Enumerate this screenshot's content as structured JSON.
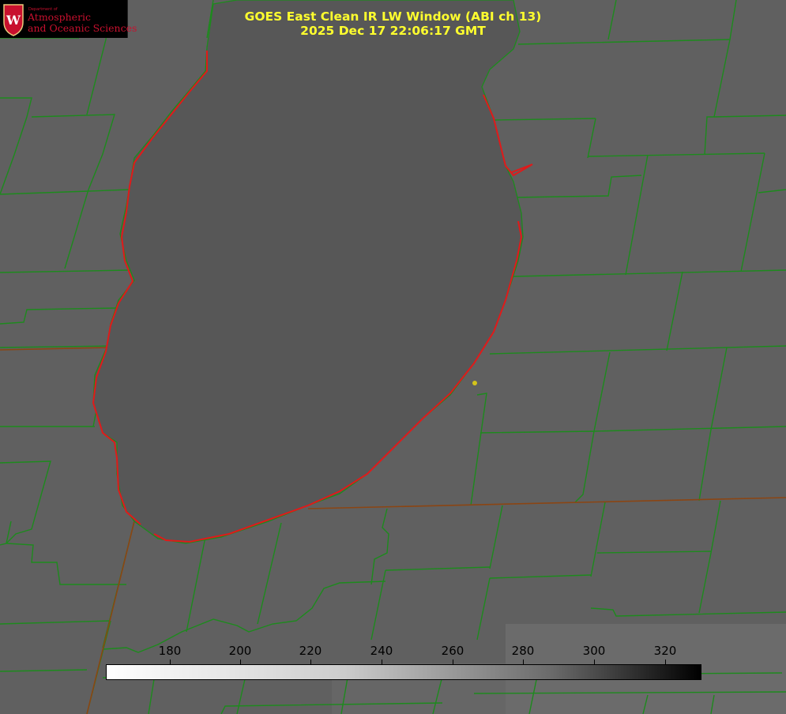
{
  "logo": {
    "department": "Department of",
    "line1": "Atmospheric",
    "line2": "and Oceanic Sciences",
    "brand_color": "#c8102e",
    "icon": "uw-crest-icon"
  },
  "title": {
    "line1": "GOES East Clean IR LW Window (ABI ch 13)",
    "line2": "2025 Dec 17 22:06:17 GMT",
    "color": "#ffff2e"
  },
  "colorbar": {
    "ticks": [
      "180",
      "200",
      "220",
      "240",
      "260",
      "280",
      "300",
      "320"
    ],
    "range": [
      162,
      330
    ],
    "gradient": "white-to-black"
  },
  "map": {
    "background_color": "#5f5f5f",
    "lake_color": "#575757",
    "county_line_color": "#1d8a1d",
    "state_line_color": "#8b4513",
    "shoreline_color": "#e01a1a",
    "marker_color": "#d4c41a"
  }
}
